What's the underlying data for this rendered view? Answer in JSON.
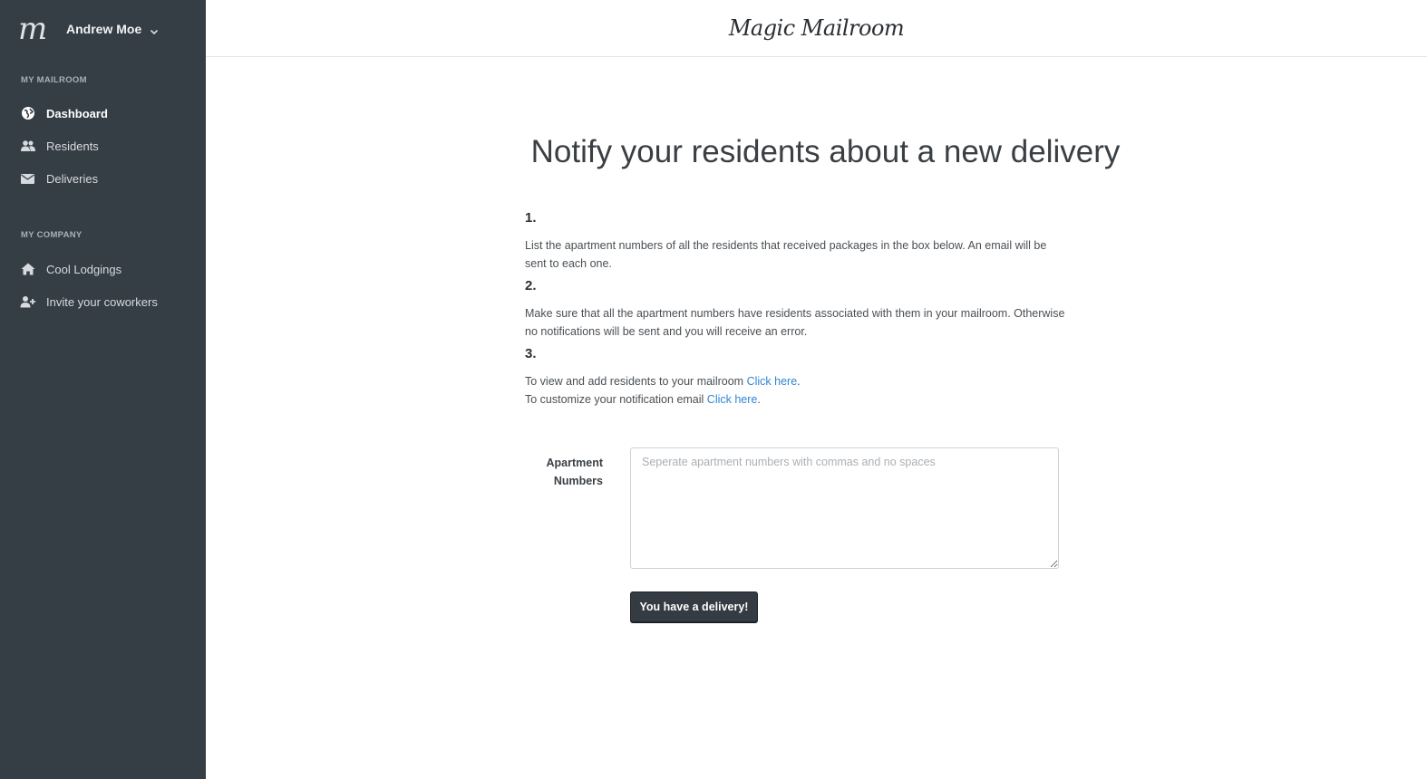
{
  "sidebar": {
    "logo": "m",
    "user_name": "Andrew Moe",
    "sections": [
      {
        "label": "MY MAILROOM",
        "items": [
          {
            "label": "Dashboard",
            "icon": "globe-icon",
            "active": true
          },
          {
            "label": "Residents",
            "icon": "users-icon",
            "active": false
          },
          {
            "label": "Deliveries",
            "icon": "envelope-icon",
            "active": false
          }
        ]
      },
      {
        "label": "MY COMPANY",
        "items": [
          {
            "label": "Cool Lodgings",
            "icon": "home-icon",
            "active": false
          },
          {
            "label": "Invite your coworkers",
            "icon": "user-plus-icon",
            "active": false
          }
        ]
      }
    ]
  },
  "header": {
    "site_title": "Magic Mailroom"
  },
  "main": {
    "title": "Notify your residents about a new delivery",
    "steps": [
      {
        "number": "1.",
        "text": "List the apartment numbers of all the residents that received packages in the box below. An email will be sent to each one."
      },
      {
        "number": "2.",
        "text": "Make sure that all the apartment numbers have residents associated with them in your mailroom. Otherwise no notifications will be sent and you will receive an error."
      },
      {
        "number": "3.",
        "line1_text": "To view and add residents to your mailroom",
        "line1_link": "Click here",
        "line2_text": "To customize your notification email",
        "line2_link": "Click here",
        "period": "."
      }
    ],
    "form": {
      "label": "Apartment Numbers",
      "value": "",
      "placeholder": "Seperate apartment numbers with commas and no spaces",
      "submit_label": "You have a delivery!"
    }
  },
  "colors": {
    "sidebar_bg": "#353d45",
    "link": "#2e86d4",
    "button_bg": "#343b42"
  }
}
